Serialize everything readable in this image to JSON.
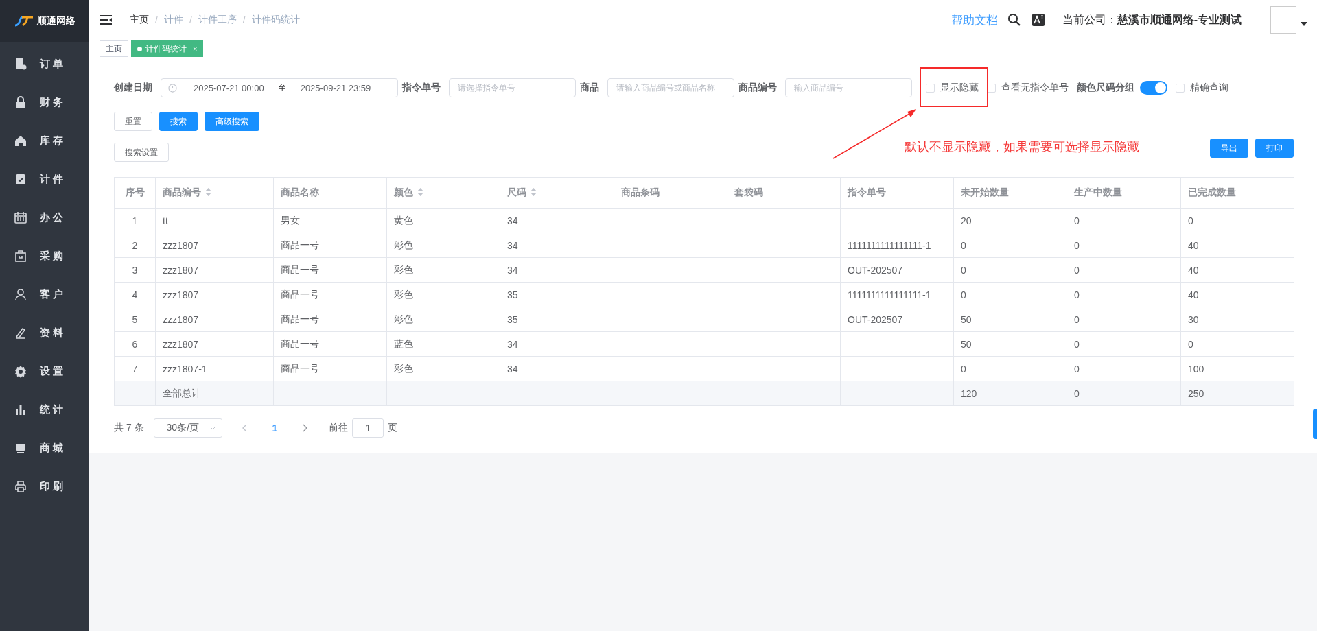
{
  "sidebar": {
    "logo": "顺通网络",
    "items": [
      {
        "label": "订 单"
      },
      {
        "label": "财 务"
      },
      {
        "label": "库 存"
      },
      {
        "label": "计 件"
      },
      {
        "label": "办 公"
      },
      {
        "label": "采 购"
      },
      {
        "label": "客 户"
      },
      {
        "label": "资 料"
      },
      {
        "label": "设 置"
      },
      {
        "label": "统 计"
      },
      {
        "label": "商 城"
      },
      {
        "label": "印 刷"
      }
    ]
  },
  "header": {
    "breadcrumbs": [
      "主页",
      "计件",
      "计件工序",
      "计件码统计"
    ],
    "breadcrumb_separator": "/",
    "help_link": "帮助文档",
    "company_label": "当前公司：",
    "company_name": "慈溪市顺通网络-专业测试"
  },
  "tabs": [
    {
      "label": "主页",
      "selected": false
    },
    {
      "label": "计件码统计",
      "selected": true,
      "close": "×"
    }
  ],
  "filters": {
    "date_label": "创建日期",
    "date_start": "2025-07-21 00:00",
    "date_separator": "至",
    "date_end": "2025-09-21 23:59",
    "fields": [
      {
        "label": "指令单号",
        "placeholder": "请选择指令单号"
      },
      {
        "label": "商品",
        "placeholder": "请输入商品编号或商品名称"
      },
      {
        "label": "商品编号",
        "placeholder": "输入商品编号"
      }
    ],
    "options": [
      {
        "kind": "checkbox",
        "label": "显示隐藏",
        "checked": false
      },
      {
        "kind": "checkbox",
        "label": "查看无指令单号",
        "checked": false
      },
      {
        "kind": "switch",
        "label": "颜色尺码分组",
        "on": true
      },
      {
        "kind": "checkbox",
        "label": "精确查询",
        "checked": false
      }
    ]
  },
  "actions": [
    {
      "label": "重置",
      "kind": "default"
    },
    {
      "label": "搜索",
      "kind": "primary"
    },
    {
      "label": "高级搜索",
      "kind": "primary"
    }
  ],
  "search_settings": "搜索设置",
  "tools": [
    "导出",
    "打印"
  ],
  "annotation": "默认不显示隐藏，如果需要可选择显示隐藏",
  "table": {
    "columns": [
      {
        "label": "序号",
        "sortable": false
      },
      {
        "label": "商品编号",
        "sortable": true
      },
      {
        "label": "商品名称",
        "sortable": false
      },
      {
        "label": "颜色",
        "sortable": true
      },
      {
        "label": "尺码",
        "sortable": true
      },
      {
        "label": "商品条码",
        "sortable": false
      },
      {
        "label": "套袋码",
        "sortable": false
      },
      {
        "label": "指令单号",
        "sortable": false
      },
      {
        "label": "未开始数量",
        "sortable": false
      },
      {
        "label": "生产中数量",
        "sortable": false
      },
      {
        "label": "已完成数量",
        "sortable": false
      }
    ],
    "rows": [
      [
        "1",
        "tt",
        "男女",
        "黄色",
        "34",
        null,
        null,
        null,
        "20",
        "0",
        "0"
      ],
      [
        "2",
        "zzz1807",
        "商品一号",
        "彩色",
        "34",
        null,
        null,
        "1111111111111111-1",
        "0",
        "0",
        "40"
      ],
      [
        "3",
        "zzz1807",
        "商品一号",
        "彩色",
        "34",
        null,
        null,
        "OUT-202507",
        "0",
        "0",
        "40"
      ],
      [
        "4",
        "zzz1807",
        "商品一号",
        "彩色",
        "35",
        null,
        null,
        "1111111111111111-1",
        "0",
        "0",
        "40"
      ],
      [
        "5",
        "zzz1807",
        "商品一号",
        "彩色",
        "35",
        null,
        null,
        "OUT-202507",
        "50",
        "0",
        "30"
      ],
      [
        "6",
        "zzz1807",
        "商品一号",
        "蓝色",
        "34",
        null,
        null,
        null,
        "50",
        "0",
        "0"
      ],
      [
        "7",
        "zzz1807-1",
        "商品一号",
        "彩色",
        "34",
        null,
        null,
        null,
        "0",
        "0",
        "100"
      ]
    ],
    "summary": {
      "label": "全部总计",
      "totals": [
        "120",
        "0",
        "250"
      ]
    }
  },
  "pagination": {
    "total": "共 7 条",
    "page_size": "30条/页",
    "pages": [
      {
        "label": "1",
        "selected": true
      }
    ],
    "goto_label": "前往",
    "goto_value": "1",
    "page_suffix": "页"
  }
}
